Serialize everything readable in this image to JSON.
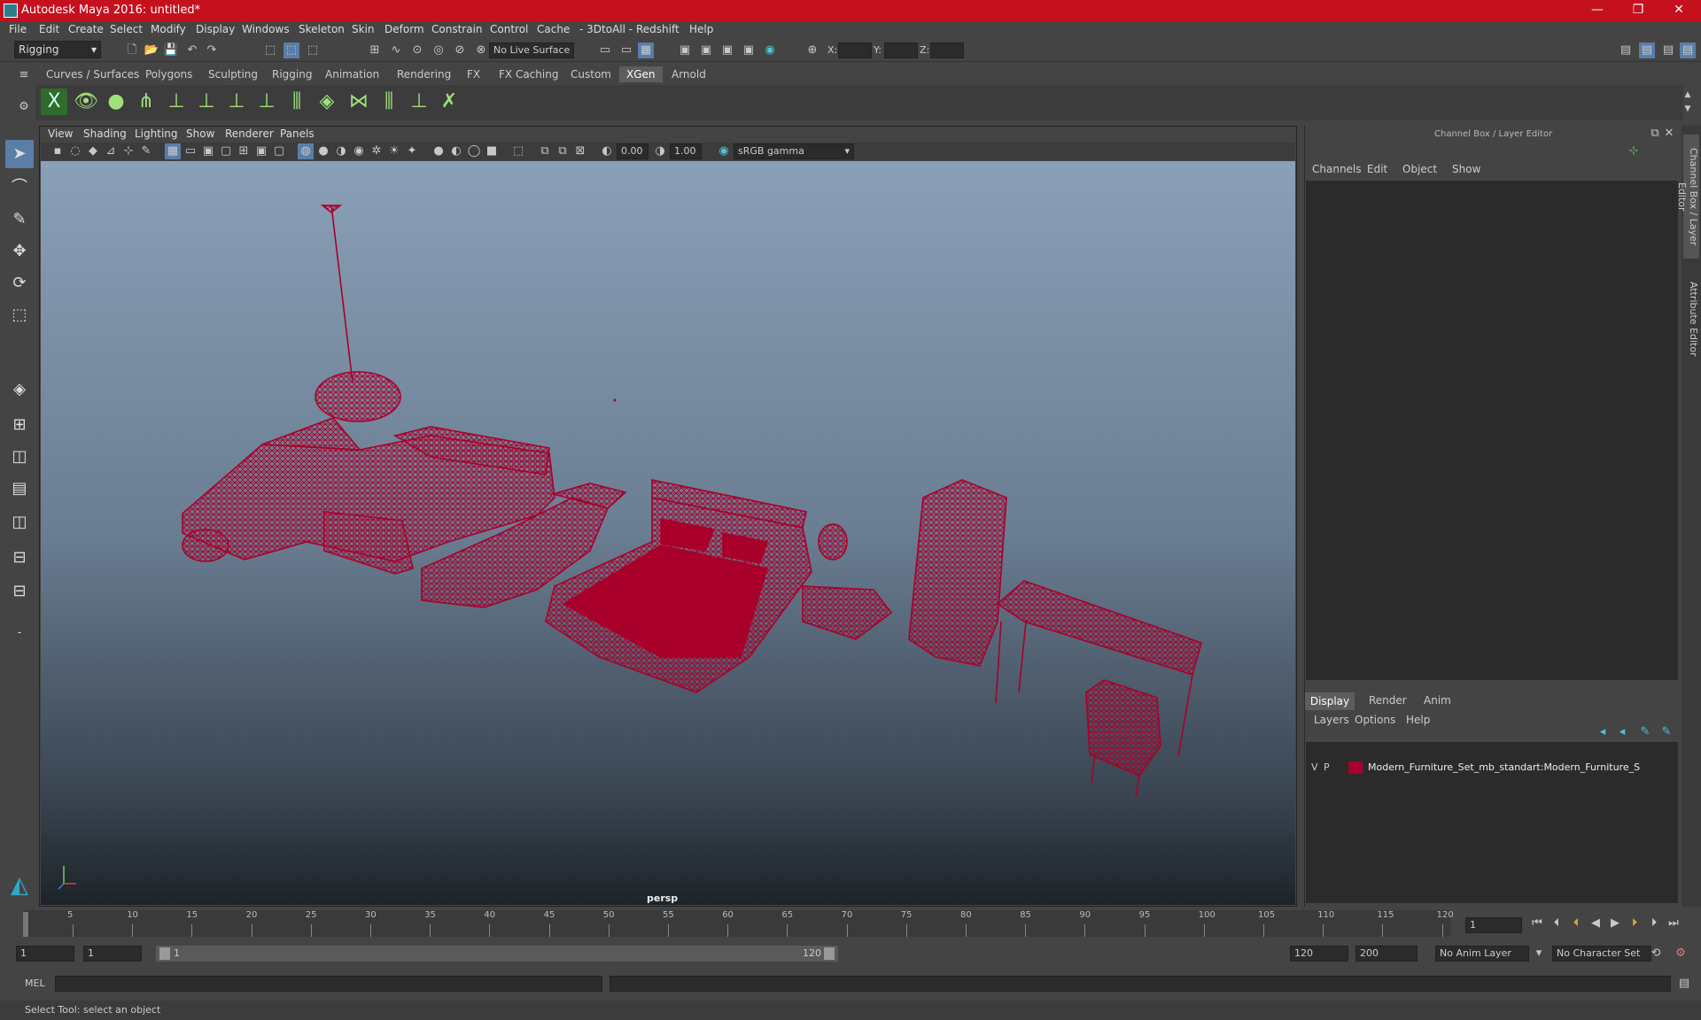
{
  "window": {
    "title": "Autodesk Maya 2016: untitled*"
  },
  "menu": [
    "File",
    "Edit",
    "Create",
    "Select",
    "Modify",
    "Display",
    "Windows",
    "Skeleton",
    "Skin",
    "Deform",
    "Constrain",
    "Control",
    "Cache",
    "- 3DtoAll -",
    "Redshift",
    "Help"
  ],
  "status": {
    "mode": "Rigging",
    "live_surface": "No Live Surface",
    "x_label": "X:",
    "y_label": "Y:",
    "z_label": "Z:"
  },
  "shelf_tabs": [
    "Curves / Surfaces",
    "Polygons",
    "Sculpting",
    "Rigging",
    "Animation",
    "Rendering",
    "FX",
    "FX Caching",
    "Custom",
    "XGen",
    "Arnold"
  ],
  "shelf_active": "XGen",
  "panel_menu": [
    "View",
    "Shading",
    "Lighting",
    "Show",
    "Renderer",
    "Panels"
  ],
  "panel_bar": {
    "exposure": "0.00",
    "gamma": "1.00",
    "colorspace": "sRGB gamma"
  },
  "viewport": {
    "camera": "persp",
    "wire_color": "#a8002a"
  },
  "channel_box": {
    "title": "Channel Box / Layer Editor",
    "menu": [
      "Channels",
      "Edit",
      "Object",
      "Show"
    ]
  },
  "layer_editor": {
    "tabs": [
      "Display",
      "Render",
      "Anim"
    ],
    "menu": [
      "Layers",
      "Options",
      "Help"
    ],
    "layer": {
      "v": "V",
      "p": "P",
      "name": "Modern_Furniture_Set_mb_standart:Modern_Furniture_S",
      "color": "#a8002a"
    }
  },
  "side_tabs": [
    "Channel Box / Layer Editor",
    "Attribute Editor"
  ],
  "timeline": {
    "ticks": [
      "5",
      "10",
      "15",
      "20",
      "25",
      "30",
      "35",
      "40",
      "45",
      "50",
      "55",
      "60",
      "65",
      "70",
      "75",
      "80",
      "85",
      "90",
      "95",
      "100",
      "105",
      "110",
      "115",
      "120"
    ],
    "current_frame": "1",
    "start_label": "1"
  },
  "range": {
    "start": "1",
    "anim_start": "1",
    "slider_start": "1",
    "slider_end": "120",
    "anim_end": "120",
    "end": "200",
    "anim_layer": "No Anim Layer",
    "char_set": "No Character Set"
  },
  "cmd": {
    "lang": "MEL"
  },
  "help": "Select Tool: select an object"
}
